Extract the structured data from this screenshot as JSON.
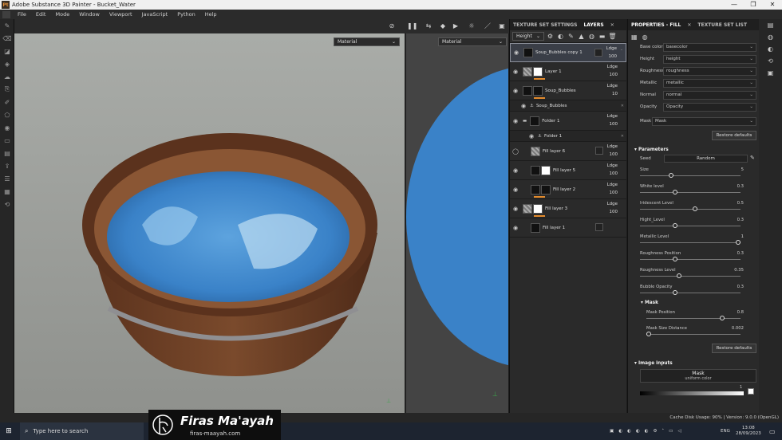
{
  "window": {
    "title": "Adobe Substance 3D Painter - Bucket_Water",
    "logo_text": "Pt",
    "controls": [
      "—",
      "❐",
      "✕"
    ]
  },
  "menu": [
    "File",
    "Edit",
    "Mode",
    "Window",
    "Viewport",
    "JavaScript",
    "Python",
    "Help"
  ],
  "viewport": {
    "left_mode": "Material",
    "right_mode": "Material"
  },
  "layers_panel": {
    "tabs": [
      "TEXTURE SET SETTINGS",
      "LAYERS"
    ],
    "tab_close": "✕",
    "channel": "Height",
    "layers": [
      {
        "name": "Soup_Bubbles copy 1",
        "blend": "Ldge",
        "opacity": "100",
        "selected": true
      },
      {
        "name": "Layer 1",
        "blend": "Ldge",
        "opacity": "100"
      },
      {
        "name": "Soup_Bubbles",
        "blend": "Ldge",
        "opacity": "10"
      },
      {
        "name": "Soup_Bubbles",
        "sub": true
      },
      {
        "name": "Folder 1",
        "blend": "Ldge",
        "opacity": "100"
      },
      {
        "name": "Folder 1",
        "sub": true
      },
      {
        "name": "Fill layer 6",
        "blend": "Ldge",
        "opacity": "100"
      },
      {
        "name": "Fill layer 5",
        "blend": "Ldge",
        "opacity": "100"
      },
      {
        "name": "Fill layer 2",
        "blend": "Ldge",
        "opacity": "100"
      },
      {
        "name": "Fill layer 3",
        "blend": "Ldge",
        "opacity": "100"
      },
      {
        "name": "Fill layer 1",
        "blend": "Ldge",
        "opacity": "100"
      }
    ]
  },
  "properties_panel": {
    "tabs": [
      "PROPERTIES - FILL",
      "TEXTURE SET LIST"
    ],
    "tab_close": "✕",
    "channels": [
      {
        "label": "Base color",
        "value": "basecolor"
      },
      {
        "label": "Height",
        "value": "height"
      },
      {
        "label": "Roughness",
        "value": "roughness"
      },
      {
        "label": "Metallic",
        "value": "metallic"
      },
      {
        "label": "Normal",
        "value": "normal"
      },
      {
        "label": "Opacity",
        "value": "Opacity"
      }
    ],
    "mask_label": "Mask",
    "mask_value": "Mask",
    "restore_defaults": "Restore defaults",
    "parameters_title": "Parameters",
    "seed_label": "Seed",
    "seed_value": "Random",
    "sliders": [
      {
        "label": "Size",
        "value": "5",
        "fraction": 0.3
      },
      {
        "label": "White level",
        "value": "0.3",
        "fraction": 0.34
      },
      {
        "label": "Iridescent Level",
        "value": "0.5",
        "fraction": 0.55
      },
      {
        "label": "Hight_Level",
        "value": "0.3",
        "fraction": 0.34
      },
      {
        "label": "Metallic Level",
        "value": "1",
        "fraction": 1.0
      },
      {
        "label": "Roughness Position",
        "value": "0.3",
        "fraction": 0.34
      },
      {
        "label": "Roughness Level",
        "value": "0.35",
        "fraction": 0.38
      },
      {
        "label": "Bubble Opacity",
        "value": "0.3",
        "fraction": 0.34
      }
    ],
    "mask_section": "Mask",
    "mask_sliders": [
      {
        "label": "Mask Position",
        "value": "0.8",
        "fraction": 0.82
      },
      {
        "label": "Mask Size Distance",
        "value": "0.002",
        "fraction": 0.0
      }
    ],
    "restore_defaults_2": "Restore defaults",
    "image_inputs_title": "Image inputs",
    "image_input_name": "Mask",
    "image_input_sub": "uniform color",
    "gradient_value": "1"
  },
  "status": {
    "text": "Cache Disk Usage:   90%  |  Version: 9.0.0 (OpenGL)"
  },
  "taskbar": {
    "search_placeholder": "Type here to search",
    "lang": "ENG",
    "time": "13:08",
    "date": "28/09/2023"
  },
  "watermark": {
    "name": "Firas Ma'ayah",
    "url": "firas-maayah.com"
  },
  "colors": {
    "accent": "#e38b2d",
    "water": "#3a82c8",
    "wood": "#6b3f26"
  }
}
